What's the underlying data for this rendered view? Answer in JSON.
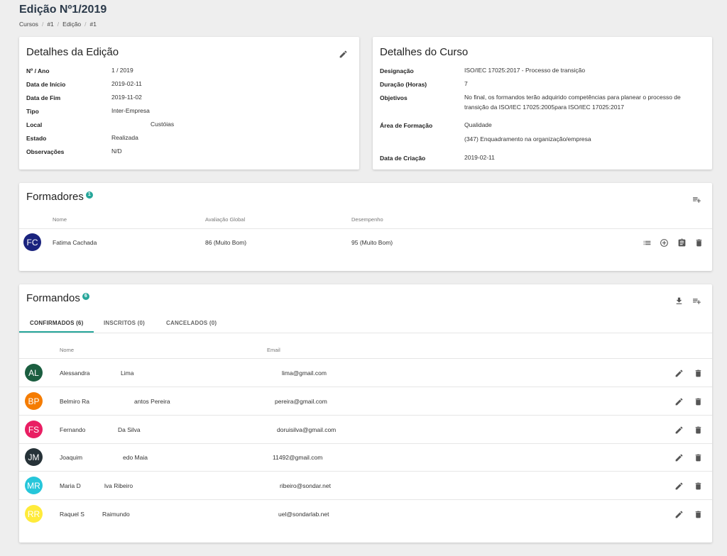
{
  "page": {
    "title": "Edição Nº1/2019",
    "breadcrumb": [
      "Cursos",
      "#1",
      "Edição",
      "#1"
    ]
  },
  "edition": {
    "title": "Detalhes da Edição",
    "fields": [
      {
        "label": "Nº / Ano",
        "value": "1 / 2019"
      },
      {
        "label": "Data de Início",
        "value": "2019-02-11"
      },
      {
        "label": "Data de Fim",
        "value": "2019-11-02"
      },
      {
        "label": "Tipo",
        "value": "Inter-Empresa"
      },
      {
        "label": "Local",
        "value": "Custóias"
      },
      {
        "label": "Estado",
        "value": "Realizada"
      },
      {
        "label": "Observações",
        "value": "N/D"
      }
    ]
  },
  "course": {
    "title": "Detalhes do Curso",
    "designacao_label": "Designação",
    "designacao": "ISO/IEC 17025:2017 - Processo de transição",
    "duracao_label": "Duração (Horas)",
    "duracao": "7",
    "objetivos_label": "Objetivos",
    "objetivos_1": "No final, os formandos terão adquirido competências para planear o processo de",
    "objetivos_2": "transição da ISO/IEC 17025:2005para ISO/IEC 17025:2017",
    "area_label": "Área de Formação",
    "area_1": "Qualidade",
    "area_2": "(347) Enquadramento na organização/empresa",
    "criacao_label": "Data de Criação",
    "criacao": "2019-02-11"
  },
  "trainers": {
    "title": "Formadores",
    "count": "1",
    "columns": {
      "name": "Nome",
      "eval": "Avaliação Global",
      "perf": "Desempenho"
    },
    "rows": [
      {
        "initials": "FC",
        "color": "#1a237e",
        "name": "Fatima Cachada",
        "eval": "86 (Muito Bom)",
        "perf": "95 (Muito Bom)"
      }
    ]
  },
  "trainees": {
    "title": "Formandos",
    "count": "6",
    "tabs": [
      "CONFIRMADOS (6)",
      "INSCRITOS (0)",
      "CANCELADOS (0)"
    ],
    "columns": {
      "name": "Nome",
      "email": "Email"
    },
    "rows": [
      {
        "initials": "AL",
        "color": "#1b5e40",
        "name_a": "Alessandra",
        "name_b": "Lima",
        "email": "lima@gmail.com"
      },
      {
        "initials": "BP",
        "color": "#f57c00",
        "name_a": "Belmiro Ra",
        "name_b": "antos Pereira",
        "email": "pereira@gmail.com"
      },
      {
        "initials": "FS",
        "color": "#e91e63",
        "name_a": "Fernando",
        "name_b": "Da Silva",
        "email": "doruisilva@gmail.com"
      },
      {
        "initials": "JM",
        "color": "#263238",
        "name_a": "Joaquim",
        "name_b": "edo Maia",
        "email": "11492@gmail.com"
      },
      {
        "initials": "MR",
        "color": "#26c6da",
        "name_a": "Maria D",
        "name_b": "lva Ribeiro",
        "email": "ribeiro@sondar.net"
      },
      {
        "initials": "RR",
        "color": "#ffeb3b",
        "name_a": "Raquel S",
        "name_b": "Raimundo",
        "email": "uel@sondarlab.net"
      }
    ]
  }
}
